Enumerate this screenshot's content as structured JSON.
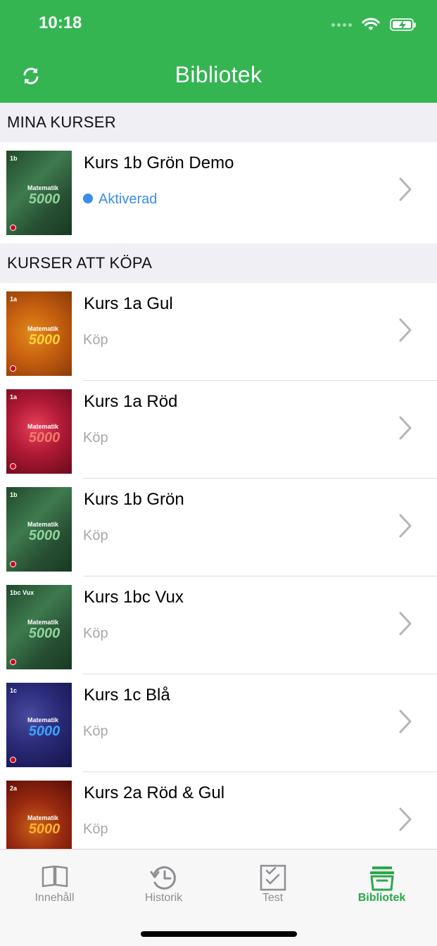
{
  "status_bar": {
    "time": "10:18"
  },
  "nav": {
    "title": "Bibliotek",
    "sync_icon": "sync-icon"
  },
  "sections": {
    "mine": "MINA KURSER",
    "buy": "KURSER ATT KÖPA"
  },
  "my_courses": [
    {
      "title": "Kurs 1b Grön Demo",
      "status": "Aktiverad",
      "cover_theme": "green",
      "cover_grade": "1b"
    }
  ],
  "buy_courses": [
    {
      "title": "Kurs 1a Gul",
      "action": "Köp",
      "cover_theme": "yellow",
      "cover_grade": "1a"
    },
    {
      "title": "Kurs 1a Röd",
      "action": "Köp",
      "cover_theme": "red",
      "cover_grade": "1a"
    },
    {
      "title": "Kurs 1b Grön",
      "action": "Köp",
      "cover_theme": "green",
      "cover_grade": "1b"
    },
    {
      "title": "Kurs 1bc Vux",
      "action": "Köp",
      "cover_theme": "green",
      "cover_grade": "1bc Vux"
    },
    {
      "title": "Kurs 1c Blå",
      "action": "Köp",
      "cover_theme": "blue",
      "cover_grade": "1c"
    },
    {
      "title": "Kurs 2a Röd & Gul",
      "action": "Köp",
      "cover_theme": "redgold",
      "cover_grade": "2a"
    }
  ],
  "cover_text": {
    "brand": "Matematik",
    "number": "5000"
  },
  "tabs": [
    {
      "label": "Innehåll",
      "icon": "book-icon",
      "selected": false
    },
    {
      "label": "Historik",
      "icon": "history-icon",
      "selected": false
    },
    {
      "label": "Test",
      "icon": "checklist-icon",
      "selected": false
    },
    {
      "label": "Bibliotek",
      "icon": "archive-icon",
      "selected": true
    }
  ],
  "colors": {
    "accent_green": "#34b552",
    "active_blue": "#3a8ee6",
    "tab_selected": "#2aa84a",
    "tab_inactive": "#8e8e93"
  }
}
